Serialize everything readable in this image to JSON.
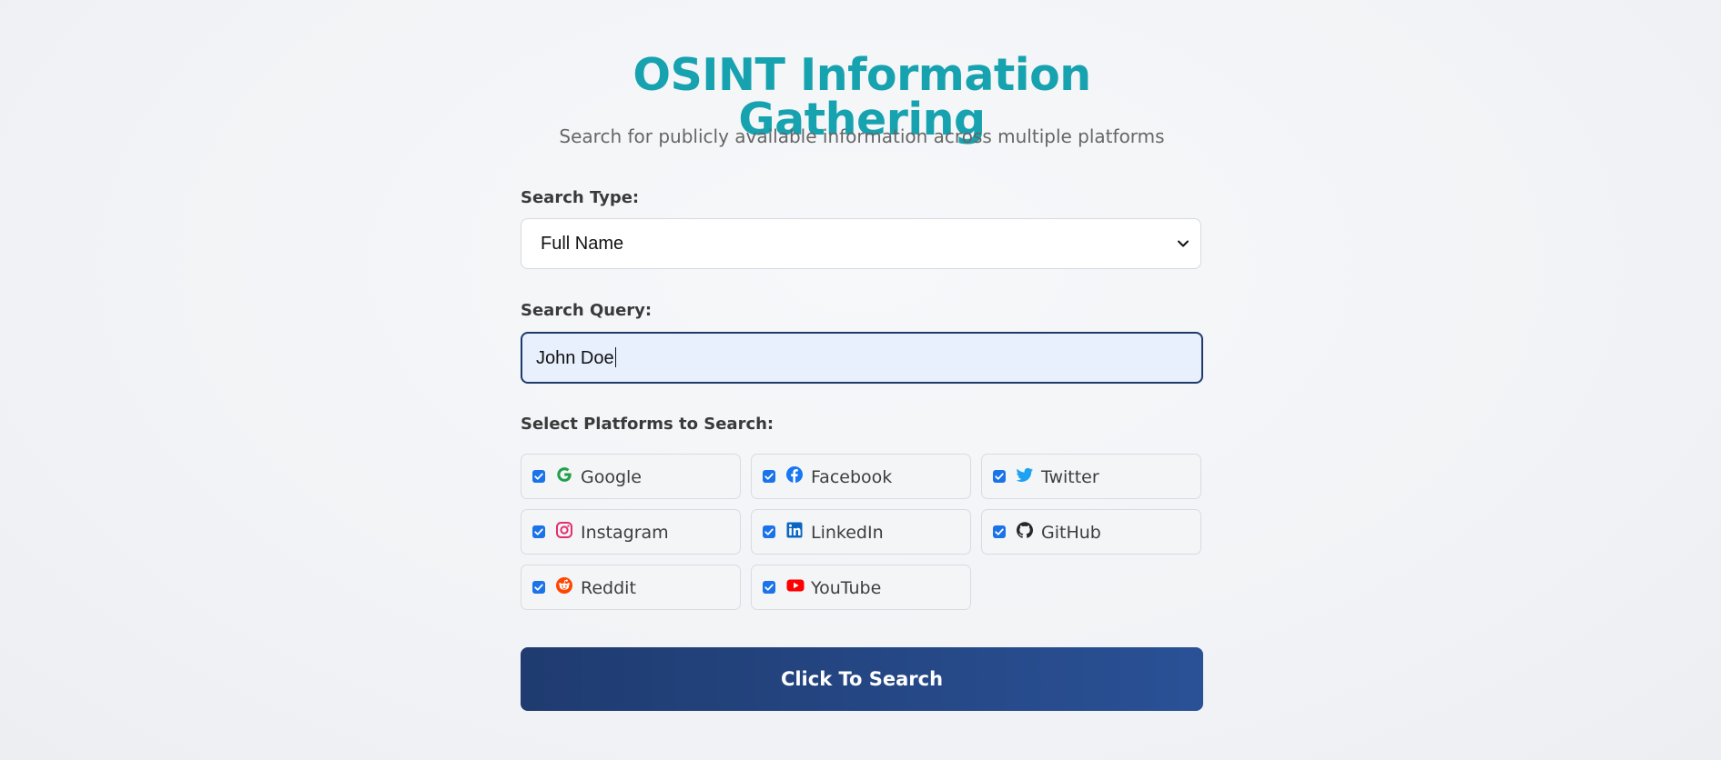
{
  "header": {
    "title": "OSINT Information Gathering",
    "subtitle": "Search for publicly available information across multiple platforms"
  },
  "search_type": {
    "label": "Search Type:",
    "selected": "Full Name"
  },
  "search_query": {
    "label": "Search Query:",
    "value": "John Doe"
  },
  "platforms": {
    "label": "Select Platforms to Search:",
    "items": [
      {
        "name": "Google",
        "checked": true,
        "icon": "google-icon",
        "color": "#34a853"
      },
      {
        "name": "Facebook",
        "checked": true,
        "icon": "facebook-icon",
        "color": "#1877f2"
      },
      {
        "name": "Twitter",
        "checked": true,
        "icon": "twitter-icon",
        "color": "#1da1f2"
      },
      {
        "name": "Instagram",
        "checked": true,
        "icon": "instagram-icon",
        "color": "#e1306c"
      },
      {
        "name": "LinkedIn",
        "checked": true,
        "icon": "linkedin-icon",
        "color": "#0a66c2"
      },
      {
        "name": "GitHub",
        "checked": true,
        "icon": "github-icon",
        "color": "#24292e"
      },
      {
        "name": "Reddit",
        "checked": true,
        "icon": "reddit-icon",
        "color": "#ff4500"
      },
      {
        "name": "YouTube",
        "checked": true,
        "icon": "youtube-icon",
        "color": "#ff0000"
      }
    ]
  },
  "actions": {
    "search_button": "Click To Search"
  },
  "colors": {
    "title": "#17a2b0",
    "button_start": "#1f3b70",
    "button_end": "#2a5196",
    "checkbox": "#1a73e8"
  }
}
